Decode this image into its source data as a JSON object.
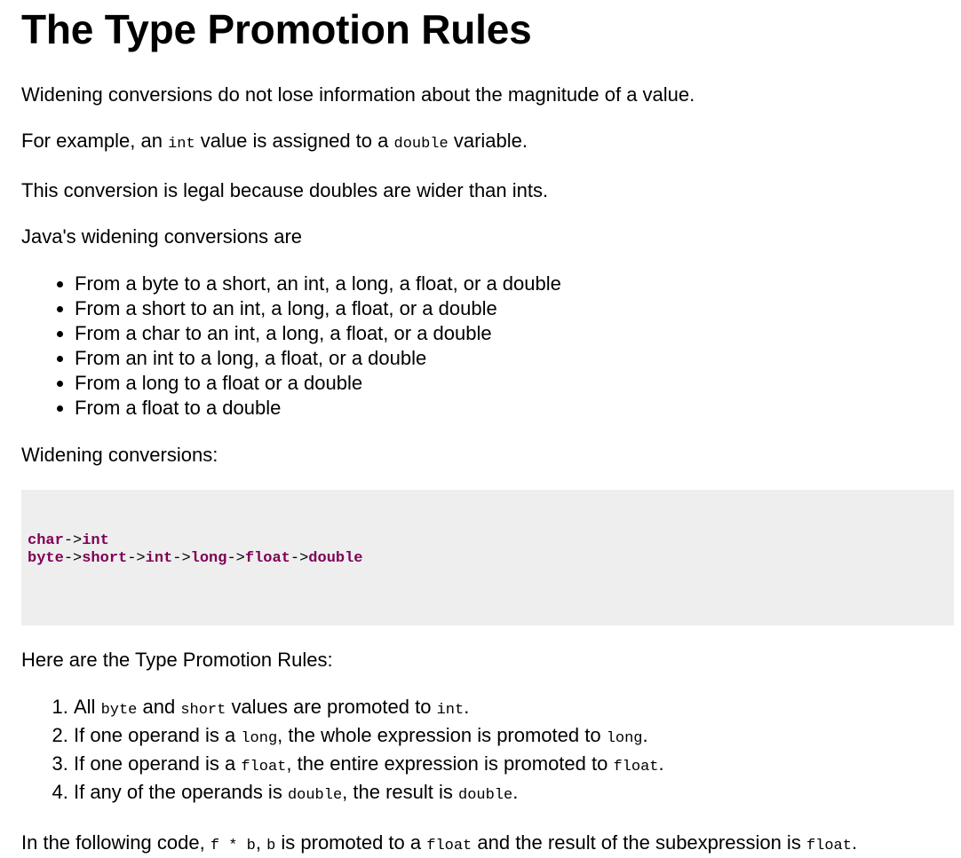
{
  "title": "The Type Promotion Rules",
  "intro": {
    "p1": "Widening conversions do not lose information about the magnitude of a value.",
    "p2_a": "For example, an ",
    "p2_code1": "int",
    "p2_b": " value is assigned to a ",
    "p2_code2": "double",
    "p2_c": " variable.",
    "p3": "This conversion is legal because doubles are wider than ints.",
    "p4": "Java's widening conversions are"
  },
  "conversions": [
    "From a byte to a short, an int, a long, a float, or a double",
    "From a short to an int, a long, a float, or a double",
    "From a char to an int, a long, a float, or a double",
    "From an int to a long, a float, or a double",
    "From a long to a float or a double",
    "From a float to a double"
  ],
  "widening_heading": "Widening conversions:",
  "code": {
    "line1": {
      "t1": "char",
      "arrow": "->",
      "t2": "int"
    },
    "line2": {
      "t1": "byte",
      "a1": "->",
      "t2": "short",
      "a2": "->",
      "t3": "int",
      "a3": "->",
      "t4": "long",
      "a4": "->",
      "t5": "float",
      "a5": "->",
      "t6": "double"
    },
    "keyword_color": "#7f0055",
    "background": "#eeeeee"
  },
  "rules_heading": "Here are the Type Promotion Rules:",
  "rules": {
    "r1": {
      "a": "All ",
      "c1": "byte",
      "b": " and ",
      "c2": "short",
      "d": " values are promoted to ",
      "c3": "int",
      "e": "."
    },
    "r2": {
      "a": "If one operand is a ",
      "c1": "long",
      "b": ", the whole expression is promoted to ",
      "c2": "long",
      "e": "."
    },
    "r3": {
      "a": "If one operand is a ",
      "c1": "float",
      "b": ", the entire expression is promoted to ",
      "c2": "float",
      "e": "."
    },
    "r4": {
      "a": "If any of the operands is ",
      "c1": "double",
      "b": ", the result is ",
      "c2": "double",
      "e": "."
    }
  },
  "final": {
    "a": "In the following code, ",
    "c1": "f * b",
    "b": ", ",
    "c2": "b",
    "c": " is promoted to a ",
    "c3": "float",
    "d": " and the result of the subexpression is ",
    "c4": "float",
    "e": "."
  }
}
